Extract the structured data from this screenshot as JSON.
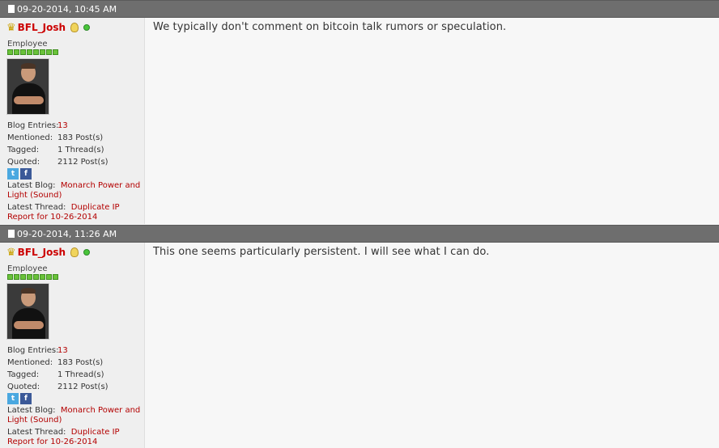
{
  "posts": [
    {
      "date": "09-20-2014, 10:45 AM",
      "username": "BFL_Josh",
      "user_title": "Employee",
      "stats": {
        "blog_entries_label": "Blog Entries:",
        "blog_entries_value": "13",
        "mentioned_label": "Mentioned:",
        "mentioned_value": "183 Post(s)",
        "tagged_label": "Tagged:",
        "tagged_value": "1 Thread(s)",
        "quoted_label": "Quoted:",
        "quoted_value": "2112 Post(s)"
      },
      "latest_blog_label": "Latest Blog:",
      "latest_blog_value": "Monarch Power and Light (Sound)",
      "latest_thread_label": "Latest Thread:",
      "latest_thread_value": "Duplicate IP Report for 10-26-2014",
      "message": "We typically don't comment on bitcoin talk rumors or speculation."
    },
    {
      "date": "09-20-2014, 11:26 AM",
      "username": "BFL_Josh",
      "user_title": "Employee",
      "stats": {
        "blog_entries_label": "Blog Entries:",
        "blog_entries_value": "13",
        "mentioned_label": "Mentioned:",
        "mentioned_value": "183 Post(s)",
        "tagged_label": "Tagged:",
        "tagged_value": "1 Thread(s)",
        "quoted_label": "Quoted:",
        "quoted_value": "2112 Post(s)"
      },
      "latest_blog_label": "Latest Blog:",
      "latest_blog_value": "Monarch Power and Light (Sound)",
      "latest_thread_label": "Latest Thread:",
      "latest_thread_value": "Duplicate IP Report for 10-26-2014",
      "message": "This one seems particularly persistent. I will see what I can do."
    }
  ],
  "icons": {
    "post_icon": "document-icon",
    "rank_icon": "crown-icon",
    "idea_icon": "lightbulb-icon",
    "status_icon": "online-status-icon",
    "social": [
      "twitter-icon",
      "facebook-icon"
    ]
  },
  "colors": {
    "header_bg": "#6e6e6e",
    "username": "#cc0000",
    "link": "#b30000",
    "reputation": "#6ac23a",
    "online": "#49c53a"
  }
}
